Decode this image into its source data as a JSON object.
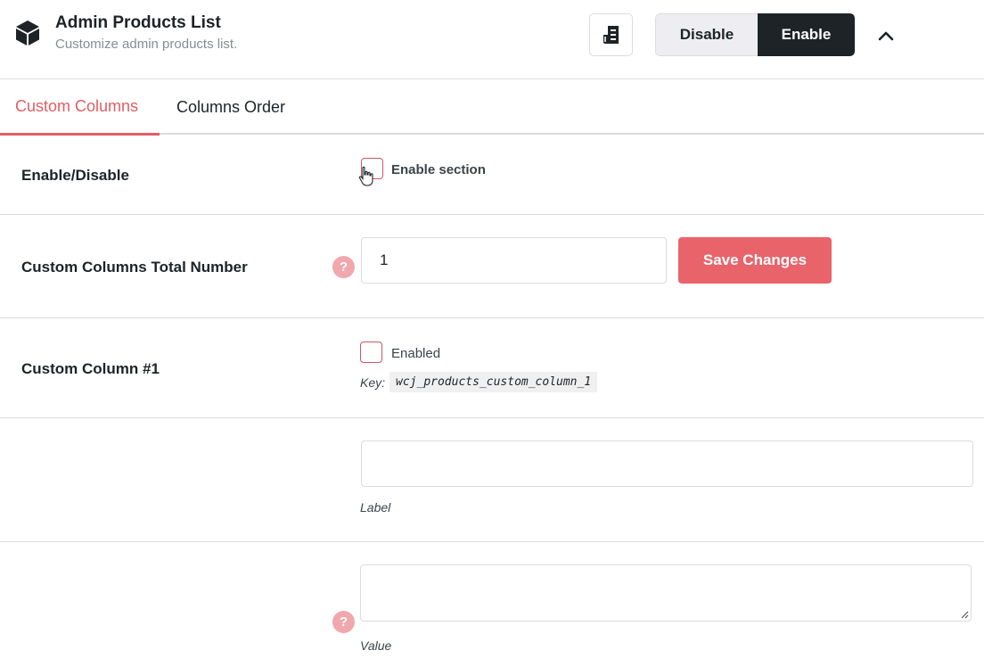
{
  "header": {
    "title": "Admin Products List",
    "subtitle": "Customize admin products list.",
    "icons": {
      "module": "box-icon",
      "docs": "document-icon",
      "collapse": "chevron-up-icon"
    },
    "toggle": {
      "disable_label": "Disable",
      "enable_label": "Enable",
      "selected": "Enable"
    }
  },
  "tabs": [
    {
      "label": "Custom Columns",
      "active": true
    },
    {
      "label": "Columns Order",
      "active": false
    }
  ],
  "settings": {
    "enable_disable": {
      "label": "Enable/Disable",
      "checkbox_label": "Enable section",
      "checked": false
    },
    "total_number": {
      "label": "Custom Columns Total Number",
      "value": "1",
      "help": "?",
      "save_label": "Save Changes"
    },
    "column_1": {
      "label": "Custom Column #1",
      "checkbox_label": "Enabled",
      "checked": false,
      "key_label": "Key:",
      "key_value": "wcj_products_custom_column_1"
    },
    "column_1_label": {
      "value": "",
      "description": "Label"
    },
    "column_1_value": {
      "value": "",
      "help": "?",
      "description": "Value"
    }
  },
  "colors": {
    "accent": "#e35d64",
    "save_button": "#e9636a",
    "dark": "#1d2327",
    "help": "#f0a7ad"
  }
}
